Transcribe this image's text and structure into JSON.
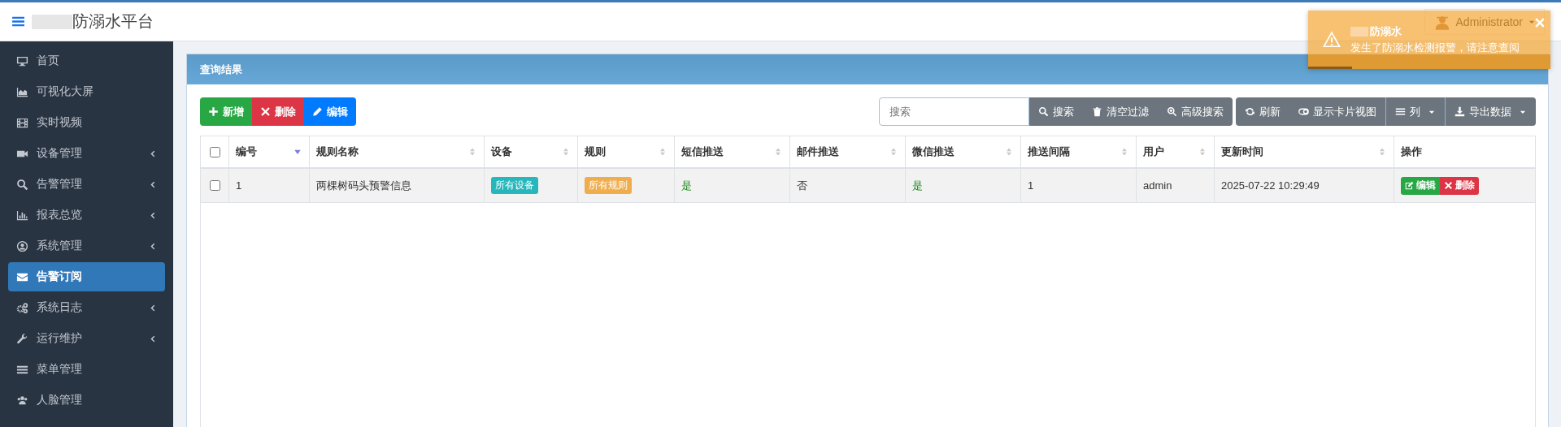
{
  "header": {
    "title": "防溺水平台",
    "user": "Administrator"
  },
  "notification": {
    "title": "防溺水",
    "message": "发生了防溺水检测报警，请注意查阅",
    "level": 0.18
  },
  "sidebar": {
    "items": [
      {
        "label": "首页",
        "expandable": false,
        "selected": false
      },
      {
        "label": "可视化大屏",
        "expandable": false,
        "selected": false
      },
      {
        "label": "实时视频",
        "expandable": false,
        "selected": false
      },
      {
        "label": "设备管理",
        "expandable": true,
        "selected": false
      },
      {
        "label": "告警管理",
        "expandable": true,
        "selected": false
      },
      {
        "label": "报表总览",
        "expandable": true,
        "selected": false
      },
      {
        "label": "系统管理",
        "expandable": true,
        "selected": false
      },
      {
        "label": "告警订阅",
        "expandable": false,
        "selected": true
      },
      {
        "label": "系统日志",
        "expandable": true,
        "selected": false
      },
      {
        "label": "运行维护",
        "expandable": true,
        "selected": false
      },
      {
        "label": "菜单管理",
        "expandable": false,
        "selected": false
      },
      {
        "label": "人脸管理",
        "expandable": false,
        "selected": false
      }
    ]
  },
  "panel": {
    "title": "查询结果"
  },
  "actions": [
    {
      "label": "新增",
      "kind": "add"
    },
    {
      "label": "删除",
      "kind": "delete"
    },
    {
      "label": "编辑",
      "kind": "edit"
    }
  ],
  "search": {
    "placeholder": "搜索"
  },
  "search_buttons": [
    {
      "label": "搜索",
      "kind": "search"
    },
    {
      "label": "清空过滤",
      "kind": "clear"
    },
    {
      "label": "高级搜索",
      "kind": "advanced"
    }
  ],
  "view_buttons": [
    {
      "label": "刷新",
      "kind": "refresh",
      "dropdown": false
    },
    {
      "label": "显示卡片视图",
      "kind": "toggle",
      "dropdown": false
    },
    {
      "label": "列",
      "kind": "columns",
      "dropdown": true
    },
    {
      "label": "导出数据",
      "kind": "export",
      "dropdown": true
    }
  ],
  "table": {
    "all_checked": false,
    "columns": [
      {
        "label": "编号",
        "sortable": true,
        "sorted": true
      },
      {
        "label": "规则名称",
        "sortable": true,
        "sorted": false
      },
      {
        "label": "设备",
        "sortable": true,
        "sorted": false
      },
      {
        "label": "规则",
        "sortable": true,
        "sorted": false
      },
      {
        "label": "短信推送",
        "sortable": true,
        "sorted": false
      },
      {
        "label": "邮件推送",
        "sortable": true,
        "sorted": false
      },
      {
        "label": "微信推送",
        "sortable": true,
        "sorted": false
      },
      {
        "label": "推送间隔",
        "sortable": true,
        "sorted": false
      },
      {
        "label": "用户",
        "sortable": true,
        "sorted": false
      },
      {
        "label": "更新时间",
        "sortable": true,
        "sorted": false
      },
      {
        "label": "操作",
        "sortable": false
      }
    ],
    "rows": [
      {
        "checked": false,
        "cells": [
          {
            "kind": "text",
            "text": "1"
          },
          {
            "kind": "text",
            "text": "两棵树码头预警信息"
          },
          {
            "kind": "badge",
            "text": "所有设备",
            "color": "#26b7bc"
          },
          {
            "kind": "badge",
            "text": "所有规则",
            "color": "#f0ad4e"
          },
          {
            "kind": "positive",
            "text": "是"
          },
          {
            "kind": "text",
            "text": "否"
          },
          {
            "kind": "positive",
            "text": "是"
          },
          {
            "kind": "text",
            "text": "1"
          },
          {
            "kind": "text",
            "text": "admin"
          },
          {
            "kind": "text",
            "text": "2025-07-22 10:29:49"
          },
          {
            "kind": "actions",
            "buttons": [
              {
                "label": "编辑",
                "kind": "edit"
              },
              {
                "label": "删除",
                "kind": "delete"
              }
            ]
          }
        ]
      }
    ]
  }
}
